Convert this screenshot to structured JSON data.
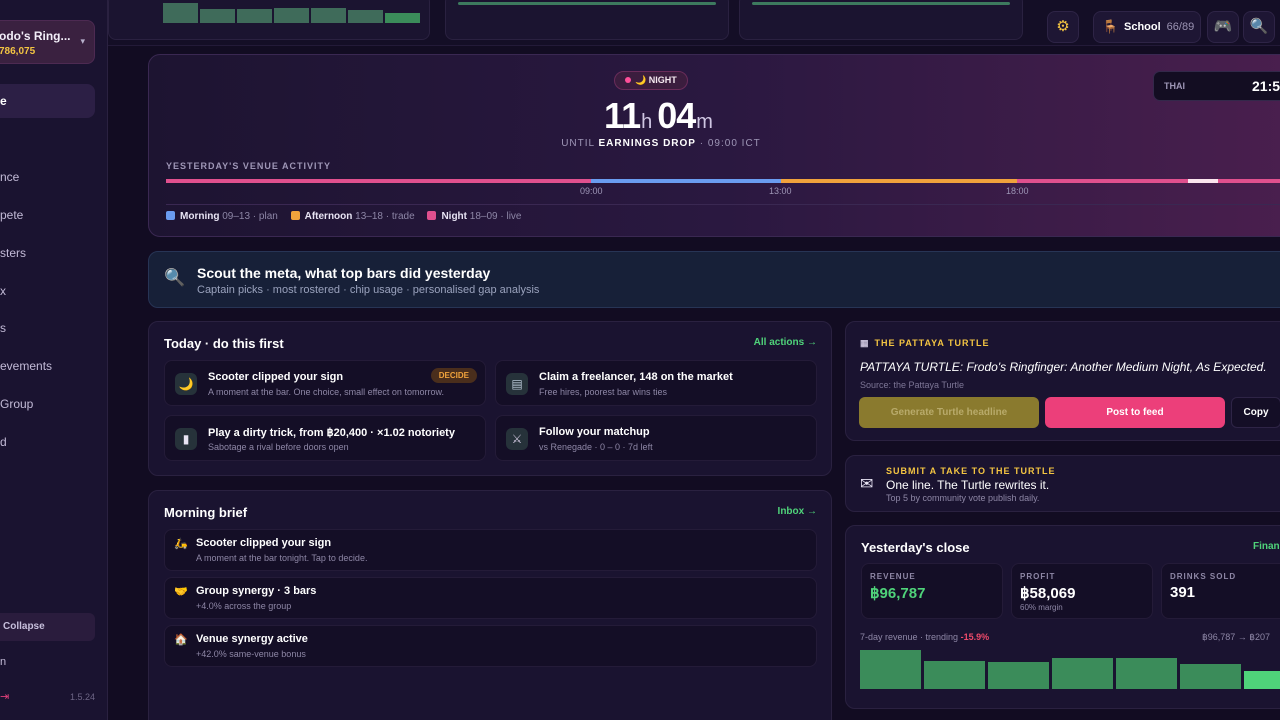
{
  "sidebar": {
    "account_name": "odo's Ring...",
    "account_balance": "786,075",
    "caret": "▾",
    "items": [
      {
        "label": "e"
      },
      {
        "label": ""
      },
      {
        "label": "nce"
      },
      {
        "label": "pete"
      },
      {
        "label": "sters"
      },
      {
        "label": "x"
      },
      {
        "label": "s"
      },
      {
        "label": "evements"
      },
      {
        "label": "Group"
      },
      {
        "label": "d"
      }
    ],
    "collapse_label": "Collapse",
    "footer_item": "n",
    "logout_icon": "⇥",
    "version": "1.5.24"
  },
  "topbar": {
    "school_label": "School",
    "school_count": "66/89",
    "school_icon": "chair-icon"
  },
  "hero": {
    "phase_label": "NIGHT",
    "hours": "11",
    "hours_unit": "h",
    "minutes": "04",
    "minutes_unit": "m",
    "until_prefix": "UNTIL",
    "until_event": "EARNINGS DROP",
    "until_suffix": "· 09:00 ICT",
    "clock_tz": "THAI",
    "clock_time": "21:5",
    "activity_label": "YESTERDAY'S VENUE ACTIVITY",
    "ticks": [
      "09:00",
      "13:00",
      "18:00"
    ],
    "legend": [
      {
        "name": "Morning",
        "range": "09–13 · plan",
        "color": "#6a9cf0"
      },
      {
        "name": "Afternoon",
        "range": "13–18 · trade",
        "color": "#f0a23c"
      },
      {
        "name": "Night",
        "range": "18–09 · live",
        "color": "#e0508e"
      }
    ]
  },
  "scout": {
    "title": "Scout the meta, what top bars did yesterday",
    "subtitle": "Captain picks · most rostered · chip usage · personalised gap analysis"
  },
  "today": {
    "title": "Today · do this first",
    "link": "All actions →",
    "actions": [
      {
        "title": "Scooter clipped your sign",
        "sub": "A moment at the bar. One choice, small effect on tomorrow.",
        "badge": "DECIDE",
        "icon": "moon-icon",
        "glyph": "🌙"
      },
      {
        "title": "Claim a freelancer, 148 on the market",
        "sub": "Free hires, poorest bar wins ties",
        "icon": "contract-icon",
        "glyph": "▤"
      },
      {
        "title": "Play a dirty trick, from ฿20,400 · ×1.02 notoriety",
        "sub": "Sabotage a rival before doors open",
        "icon": "trick-card-icon",
        "glyph": "▮"
      },
      {
        "title": "Follow your matchup",
        "sub": "vs Renegade · 0 – 0 · 7d left",
        "icon": "crossed-swords-icon",
        "glyph": "⚔"
      }
    ]
  },
  "brief": {
    "title": "Morning brief",
    "link": "Inbox →",
    "items": [
      {
        "title": "Scooter clipped your sign",
        "sub": "A moment at the bar tonight. Tap to decide.",
        "icon": "scooter-icon",
        "glyph": "🛵"
      },
      {
        "title": "Group synergy · 3 bars",
        "sub": "+4.0% across the group",
        "icon": "handshake-icon",
        "glyph": "🤝"
      },
      {
        "title": "Venue synergy active",
        "sub": "+42.0% same-venue bonus",
        "icon": "house-icon",
        "glyph": "🏠"
      }
    ]
  },
  "turtle": {
    "header": "THE PATTAYA TURTLE",
    "quote": "PATTAYA TURTLE: Frodo's Ringfinger: Another Medium Night, As Expected.",
    "source": "Source: the Pattaya Turtle",
    "generate_label": "Generate Turtle headline",
    "post_label": "Post to feed",
    "copy_label": "Copy"
  },
  "take": {
    "header": "SUBMIT A TAKE TO THE TURTLE",
    "title": "One line. The Turtle rewrites it.",
    "sub": "Top 5 by community vote publish daily."
  },
  "close": {
    "title": "Yesterday's close",
    "link": "Financ",
    "stats": [
      {
        "label": "REVENUE",
        "value": "฿96,787",
        "sub": "",
        "color": "#4fd37a"
      },
      {
        "label": "PROFIT",
        "value": "฿58,069",
        "sub": "60% margin",
        "color": "#ffffff"
      },
      {
        "label": "DRINKS SOLD",
        "value": "391",
        "sub": "",
        "color": "#ffffff"
      }
    ],
    "trend_label": "7-day revenue · trending",
    "trend_value": "-15.9%",
    "trend_range": "฿96,787 → ฿207",
    "bar_levels": [
      0.9,
      0.66,
      0.63,
      0.73,
      0.73,
      0.58,
      0.42
    ]
  },
  "colors": {
    "accent_green": "#4fd37a",
    "accent_pink": "#ec3f7a",
    "accent_gold": "#f4c542"
  }
}
